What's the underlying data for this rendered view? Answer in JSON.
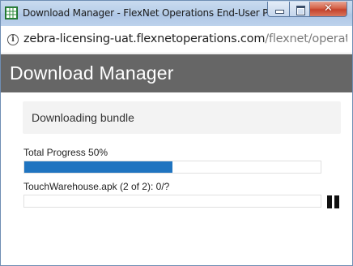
{
  "window": {
    "title": "Download Manager - FlexNet Operations End-User Port...",
    "close_glyph": "✕",
    "icon": "spreadsheet-grid-icon"
  },
  "address": {
    "info_glyph": "i",
    "host": "zebra-licensing-uat.flexnetoperations.com",
    "path": "/flexnet/operationsp..."
  },
  "header": {
    "title": "Download Manager"
  },
  "status": {
    "text": "Downloading bundle"
  },
  "total": {
    "label": "Total Progress 50%",
    "progress": 0.5
  },
  "file": {
    "label": "TouchWarehouse.apk (2 of 2): 0/?",
    "progress": 0
  },
  "colors": {
    "progress_fill": "#1f74c0",
    "header_bg": "#666666"
  }
}
